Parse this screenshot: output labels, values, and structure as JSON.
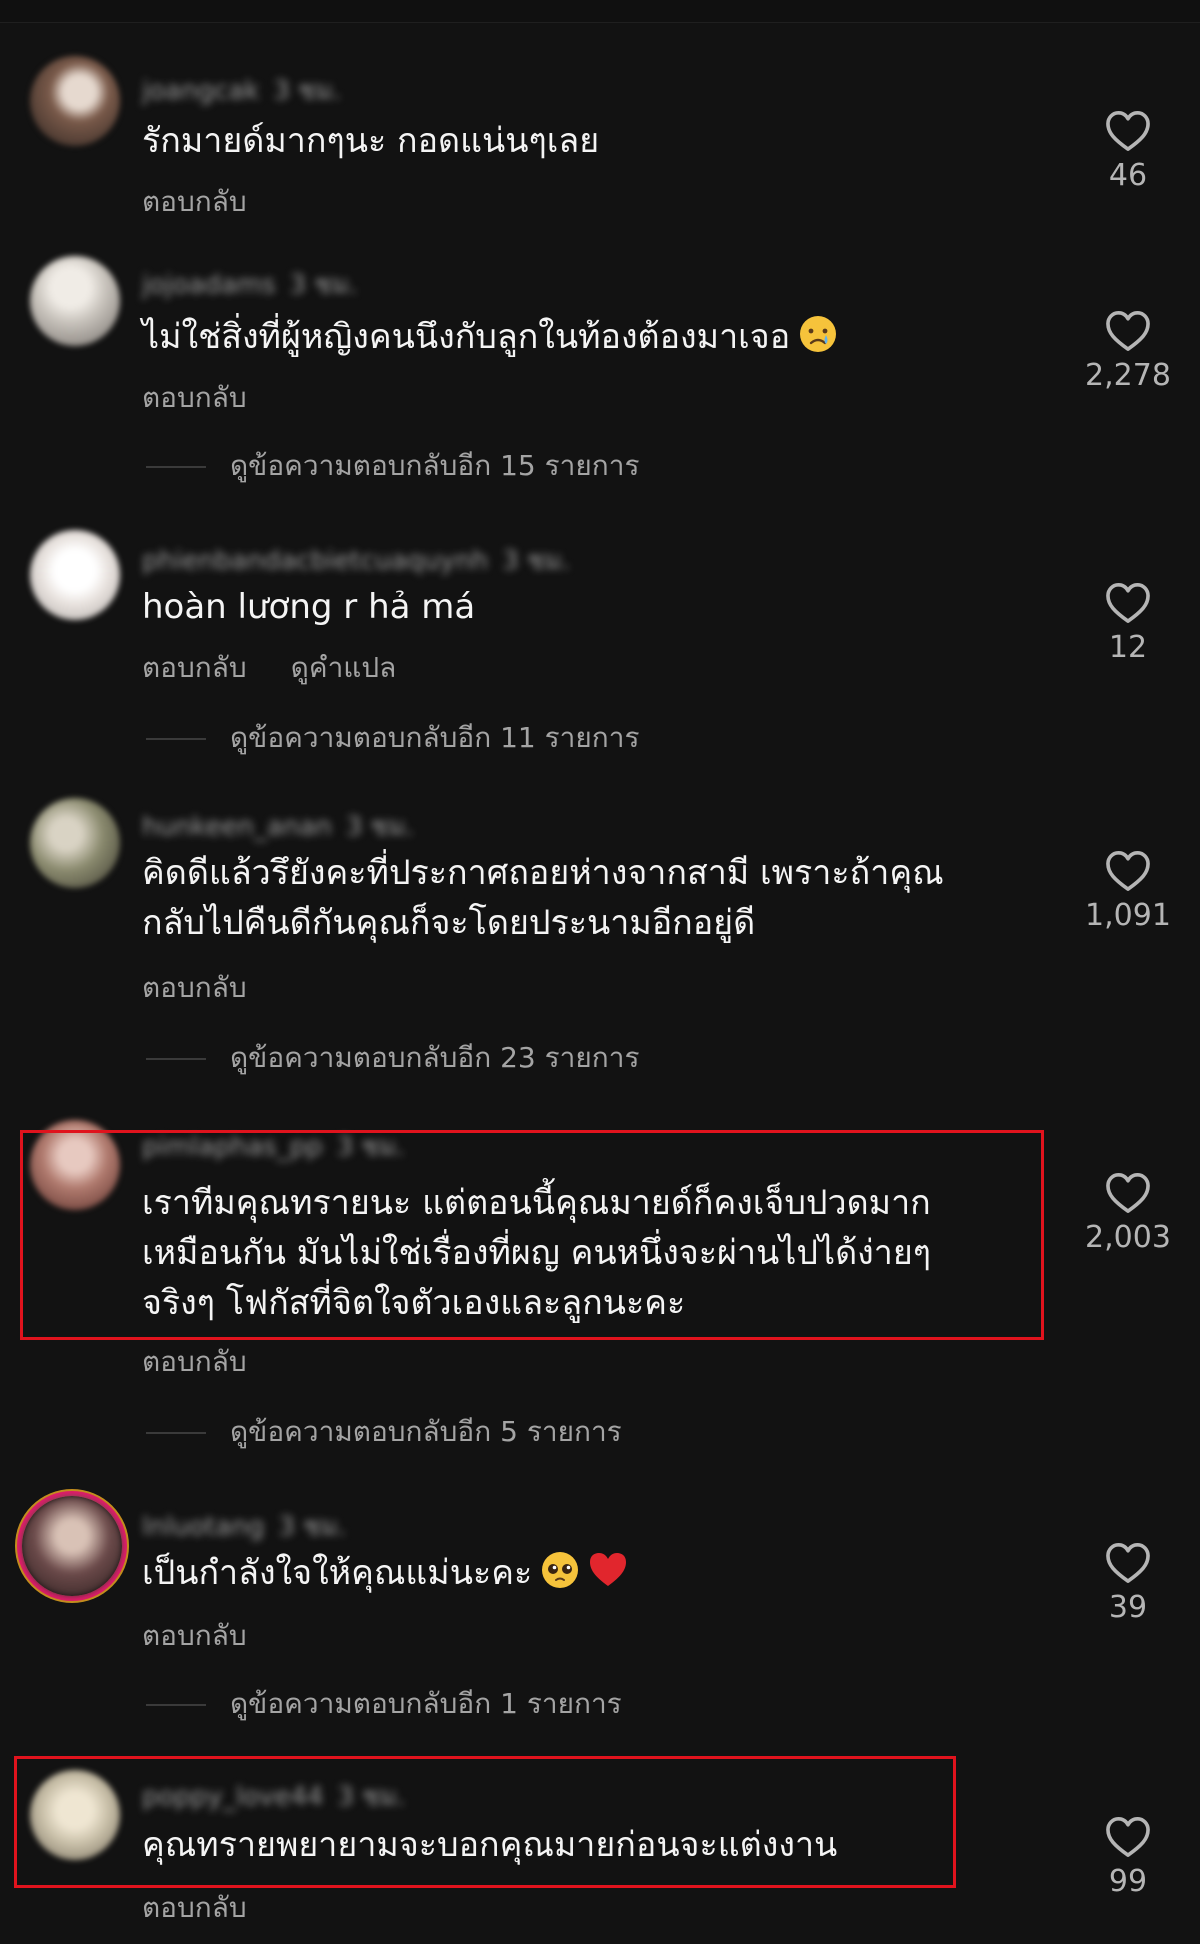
{
  "comments": [
    {
      "username": "joangcak",
      "time": "3 ชม.",
      "text": "รักมายด์มากๆนะ กอดแน่นๆเลย",
      "reply_label": "ตอบกลับ",
      "likes": "46",
      "avatar_color": "#7a5a4a"
    },
    {
      "username": "jojoadams",
      "time": "3 ชม.",
      "text": "ไม่ใช่สิ่งที่ผู้หญิงคนนึงกับลูกในท้องต้องมาเจอ",
      "emoji": "crying-face-emoji",
      "reply_label": "ตอบกลับ",
      "likes": "2,278",
      "more_replies": "ดูข้อความตอบกลับอีก 15 รายการ",
      "avatar_color": "#c9c4bd"
    },
    {
      "username": "phienbandacbietcuaquynh",
      "time": "3 ชม.",
      "text": "hoàn lương r hả má",
      "reply_label": "ตอบกลับ",
      "translate_label": "ดูคำแปล",
      "likes": "12",
      "more_replies": "ดูข้อความตอบกลับอีก 11 รายการ",
      "avatar_color": "#e9e3df"
    },
    {
      "username": "hunkeen_anan",
      "time": "3 ชม.",
      "text": "คิดดีแล้วรึยังคะที่ประกาศถอยห่างจากสามี เพราะถ้าคุณ\nกลับไปคืนดีกันคุณก็จะโดยประนามอีกอยู่ดี",
      "reply_label": "ตอบกลับ",
      "likes": "1,091",
      "more_replies": "ดูข้อความตอบกลับอีก 23 รายการ",
      "avatar_color": "#8a8a6e"
    },
    {
      "username": "pimlaphas_pp",
      "time": "3 ชม.",
      "text": "เราทีมคุณทรายนะ แต่ตอนนี้คุณมายด์ก็คงเจ็บปวดมาก\nเหมือนกัน มันไม่ใช่เรื่องที่ผญ คนหนึ่งจะผ่านไปได้ง่ายๆ\nจริงๆ  โฟกัสที่จิตใจตัวเองและลูกนะคะ",
      "reply_label": "ตอบกลับ",
      "likes": "2,003",
      "more_replies": "ดูข้อความตอบกลับอีก 5 รายการ",
      "avatar_color": "#b07a6e"
    },
    {
      "username": "lnluotang",
      "time": "3 ชม.",
      "text": "เป็นกำลังใจให้คุณแม่นะคะ",
      "emoji": "pleading-face-heart-emoji",
      "reply_label": "ตอบกลับ",
      "likes": "39",
      "more_replies": "ดูข้อความตอบกลับอีก 1 รายการ",
      "avatar_color": "#6b4a4a"
    },
    {
      "username": "poppy_love44",
      "time": "3 ชม.",
      "text": "คุณทรายพยายามจะบอกคุณมายก่อนจะแต่งงาน",
      "reply_label": "ตอบกลับ",
      "likes": "99",
      "avatar_color": "#c8bfa8"
    }
  ],
  "colors": {
    "background": "#121212",
    "highlight_border": "#e0131d",
    "secondary_text": "#a4a4a4"
  },
  "icons": {
    "like": "heart-outline-icon"
  }
}
